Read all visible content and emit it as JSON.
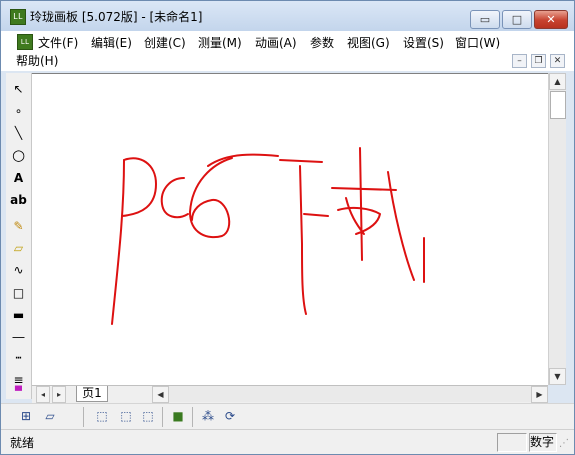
{
  "window": {
    "title": "玲珑画板 [5.072版] - [未命名1]",
    "app_icon_text": "LL",
    "minimize_glyph": "▭",
    "maximize_glyph": "□",
    "close_glyph": "✕"
  },
  "menu": {
    "items": [
      "文件(F)",
      "编辑(E)",
      "创建(C)",
      "测量(M)",
      "动画(A)",
      "参数",
      "视图(G)",
      "设置(S)",
      "窗口(W)",
      "帮助(H)"
    ],
    "mdi_minimize": "–",
    "mdi_restore": "❐",
    "mdi_close": "✕"
  },
  "toolbox": {
    "tools": [
      {
        "name": "arrow-pointer-icon",
        "glyph": "↖"
      },
      {
        "name": "point-tool-icon",
        "glyph": "∘"
      },
      {
        "name": "line-tool-icon",
        "glyph": "╲"
      },
      {
        "name": "circle-tool-icon",
        "glyph": "○"
      },
      {
        "name": "text-tool-icon",
        "glyph": "A"
      },
      {
        "name": "label-tool-icon",
        "glyph": "ab"
      },
      {
        "name": "pencil-tool-icon",
        "glyph": "✎"
      },
      {
        "name": "eraser-tool-icon",
        "glyph": "▱"
      },
      {
        "name": "curve-tool-icon",
        "glyph": "∿"
      },
      {
        "name": "rectangle-tool-icon",
        "glyph": "□"
      },
      {
        "name": "thick-line-icon",
        "glyph": "▬"
      },
      {
        "name": "thin-line-icon",
        "glyph": "―"
      },
      {
        "name": "dotted-line-icon",
        "glyph": "┅"
      },
      {
        "name": "multi-line-icon",
        "glyph": "≡"
      },
      {
        "name": "color-palette-icon",
        "glyph": "▀"
      }
    ]
  },
  "canvas": {
    "stroke_color": "#dd1111"
  },
  "pages": {
    "tab_label": "页1"
  },
  "bottom_toolbar": {
    "buttons": [
      {
        "name": "grid-icon",
        "glyph": "⊞"
      },
      {
        "name": "oblique-grid-icon",
        "glyph": "▱"
      },
      {
        "name": "cube-front-icon",
        "glyph": "⬚"
      },
      {
        "name": "cube-top-icon",
        "glyph": "⬚"
      },
      {
        "name": "cube-side-icon",
        "glyph": "⬚"
      },
      {
        "name": "fill-color-icon",
        "glyph": "■"
      },
      {
        "name": "axes-icon",
        "glyph": "⁂"
      },
      {
        "name": "rotate-icon",
        "glyph": "⟳"
      }
    ]
  },
  "status": {
    "text": "就绪",
    "pane_num": "数字"
  },
  "colors": {
    "title_bg": "#c3d5ec",
    "close_red": "#c7422f",
    "app_green": "#3f7a1e"
  }
}
